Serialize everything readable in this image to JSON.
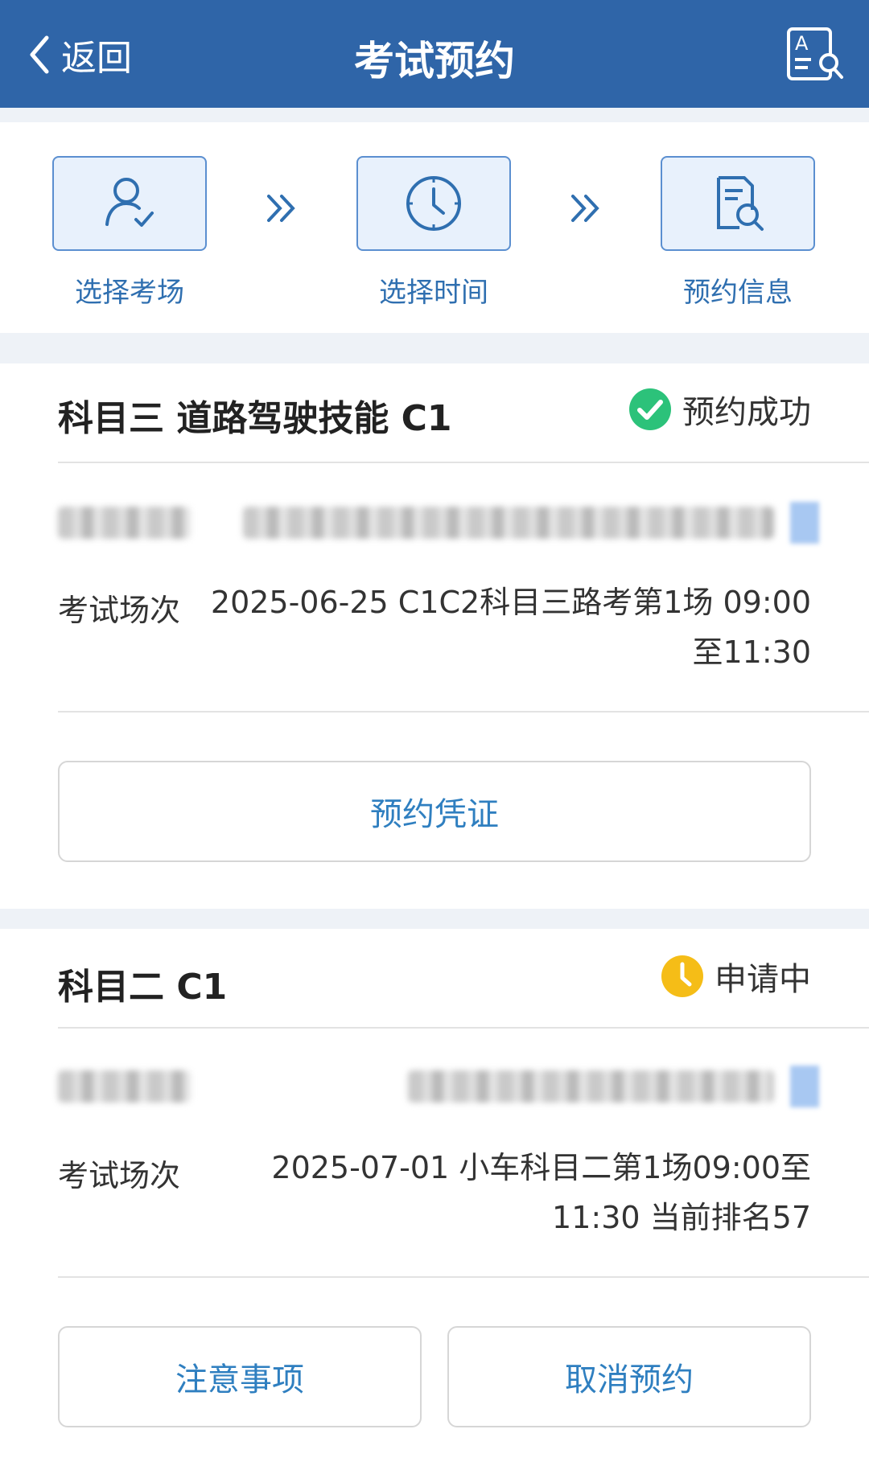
{
  "header": {
    "back_label": "返回",
    "title": "考试预约",
    "action_icon": "doc-search-icon"
  },
  "steps": [
    {
      "label": "选择考场",
      "icon": "user-check-icon"
    },
    {
      "label": "选择时间",
      "icon": "clock-icon"
    },
    {
      "label": "预约信息",
      "icon": "doc-search-icon"
    }
  ],
  "bookings": [
    {
      "subject": "科目三 道路驾驶技能 C1",
      "status": "预约成功",
      "status_color": "#2cc27a",
      "session_label": "考试场次",
      "session_value_line1": "2025-06-25 C1C2科目三路考第1场 09:00",
      "session_value_line2": "至11:30",
      "button": "预约凭证"
    },
    {
      "subject": "科目二 C1",
      "status": "申请中",
      "status_color": "#f5bd17",
      "session_label": "考试场次",
      "session_value_line1": "2025-07-01 小车科目二第1场09:00至",
      "session_value_line2": "11:30 当前排名57",
      "buttons": [
        "注意事项",
        "取消预约"
      ]
    }
  ],
  "colors": {
    "header_bg": "#2f65a8",
    "accent": "#2f7fc0",
    "page_bg": "#eef2f7"
  }
}
